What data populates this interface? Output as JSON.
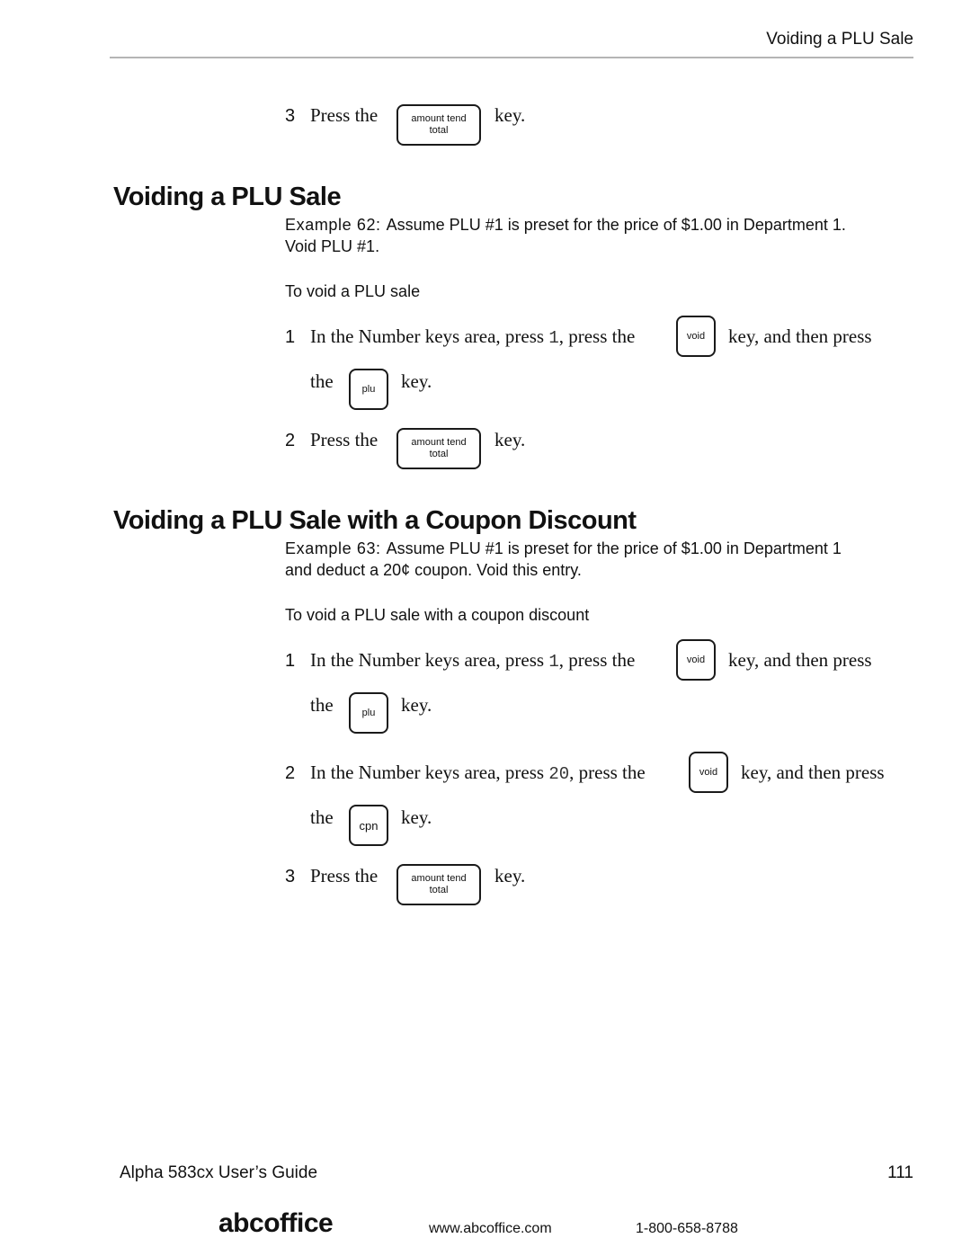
{
  "header": {
    "running_title": "Voiding a PLU Sale"
  },
  "top_step": {
    "number": "3",
    "before": "Press the",
    "key": [
      "amount tend",
      "total"
    ],
    "after": "key."
  },
  "section1": {
    "title": "Voiding a PLU Sale",
    "example_label": "Example 62:",
    "example_text_line1": "Assume PLU #1 is preset for the price of $1.00 in Department 1.",
    "example_text_line2": "Void PLU #1.",
    "procedure_title": "To void a PLU sale",
    "steps": [
      {
        "number": "1",
        "text_a": "In the Number keys area, press ",
        "code": "1",
        "text_b": ", press the",
        "key1": "void",
        "text_c": "key, and then press",
        "text_d": "the",
        "key2": "plu",
        "text_e": "key."
      },
      {
        "number": "2",
        "before": "Press the",
        "key": [
          "amount tend",
          "total"
        ],
        "after": "key."
      }
    ]
  },
  "section2": {
    "title": "Voiding a PLU Sale with a Coupon Discount",
    "example_label": "Example 63:",
    "example_text_line1": "Assume PLU #1 is preset for the price of $1.00 in Department 1",
    "example_text_line2": "and deduct a 20¢ coupon. Void this entry.",
    "procedure_title": "To void a PLU sale with a coupon discount",
    "steps": [
      {
        "number": "1",
        "text_a": "In the Number keys area, press ",
        "code": "1",
        "text_b": ", press the",
        "key1": "void",
        "text_c": "key, and then press",
        "text_d": "the",
        "key2": "plu",
        "text_e": "key."
      },
      {
        "number": "2",
        "text_a": "In the Number keys area, press ",
        "code": "20",
        "text_b": ", press the",
        "key1": "void",
        "text_c": "key, and then press",
        "text_d": "the",
        "key2": "cpn",
        "text_e": "key."
      },
      {
        "number": "3",
        "before": "Press the",
        "key": [
          "amount tend",
          "total"
        ],
        "after": "key."
      }
    ]
  },
  "footer": {
    "guide_title": "Alpha 583cx  User’s Guide",
    "page_number": "111",
    "brand": "abcoffice",
    "url": "www.abcoffice.com",
    "phone": "1-800-658-8788"
  }
}
